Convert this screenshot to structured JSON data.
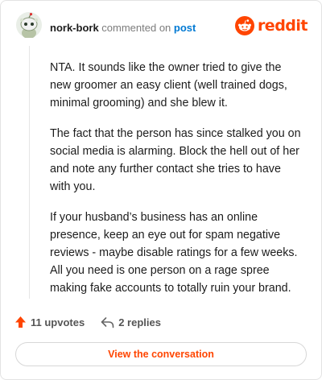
{
  "header": {
    "username": "nork-bork",
    "action_text": "commented on",
    "post_link": "post",
    "logo_text": "reddit"
  },
  "comment": {
    "paragraphs": [
      "NTA. It sounds like the owner tried to give the new groomer an easy client (well trained dogs, minimal grooming) and she blew it.",
      "The fact that the person has since stalked you on social media is alarming. Block the hell out of her and note any further contact she tries to have with you.",
      "If your husband’s business has an online presence, keep an eye out for spam negative reviews - maybe disable ratings for a few weeks. All you need is one person on a rage spree making fake accounts to totally ruin your brand."
    ]
  },
  "actions": {
    "upvotes": "11 upvotes",
    "replies": "2 replies"
  },
  "cta": {
    "label": "View the conversation"
  },
  "colors": {
    "accent": "#ff4500",
    "link": "#0079d3",
    "upvote": "#ff4500"
  },
  "icons": {
    "avatar": "snoo-avatar-icon",
    "logo": "reddit-logo-icon",
    "upvote": "upvote-arrow-icon",
    "reply": "reply-arrow-icon"
  }
}
